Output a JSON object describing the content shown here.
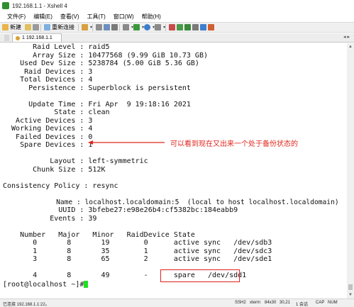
{
  "window": {
    "title": "192.168.1.1 - Xshell 4"
  },
  "menu": [
    "文件(F)",
    "编辑(E)",
    "查看(V)",
    "工具(T)",
    "窗口(W)",
    "帮助(H)"
  ],
  "toolbar": {
    "new_label": "新建",
    "reconnect_label": "重新连接"
  },
  "tab": {
    "label": "1 192.168.1.1"
  },
  "terminal": {
    "lines": [
      "       Raid Level : raid5",
      "       Array Size : 10477568 (9.99 GiB 10.73 GB)",
      "    Used Dev Size : 5238784 (5.00 GiB 5.36 GB)",
      "     Raid Devices : 3",
      "    Total Devices : 4",
      "      Persistence : Superblock is persistent",
      "",
      "      Update Time : Fri Apr  9 19:18:16 2021",
      "            State : clean",
      "   Active Devices : 3",
      "  Working Devices : 4",
      "   Failed Devices : 0",
      "    Spare Devices : 1",
      "",
      "           Layout : left-symmetric",
      "       Chunk Size : 512K",
      "",
      "Consistency Policy : resync",
      "",
      "             Name : localhost.localdomain:5  (local to host localhost.localdomain)",
      "             UUID : 3bfebe27:e98e26b4:cf5382bc:184eabb9",
      "           Events : 39",
      "",
      "    Number   Major   Minor   RaidDevice State",
      "       0       8       19        0      active sync   /dev/sdb3",
      "       1       8       35        1      active sync   /dev/sdc3",
      "       3       8       65        2      active sync   /dev/sde1",
      "",
      "       4       8       49        -      spare   /dev/sdd1",
      "[root@localhost ~]# "
    ]
  },
  "annotation": {
    "text": "可以看到现在又出来一个处于备份状态的",
    "color": "#e1261c"
  },
  "status": {
    "connection": "已连接 192.168.1.1:22。",
    "protocol": "SSH2",
    "term": "xterm",
    "size": "84x30",
    "cursor": "30,21",
    "sessions": "1 会话",
    "caps": "CAP",
    "num": "NUM"
  }
}
